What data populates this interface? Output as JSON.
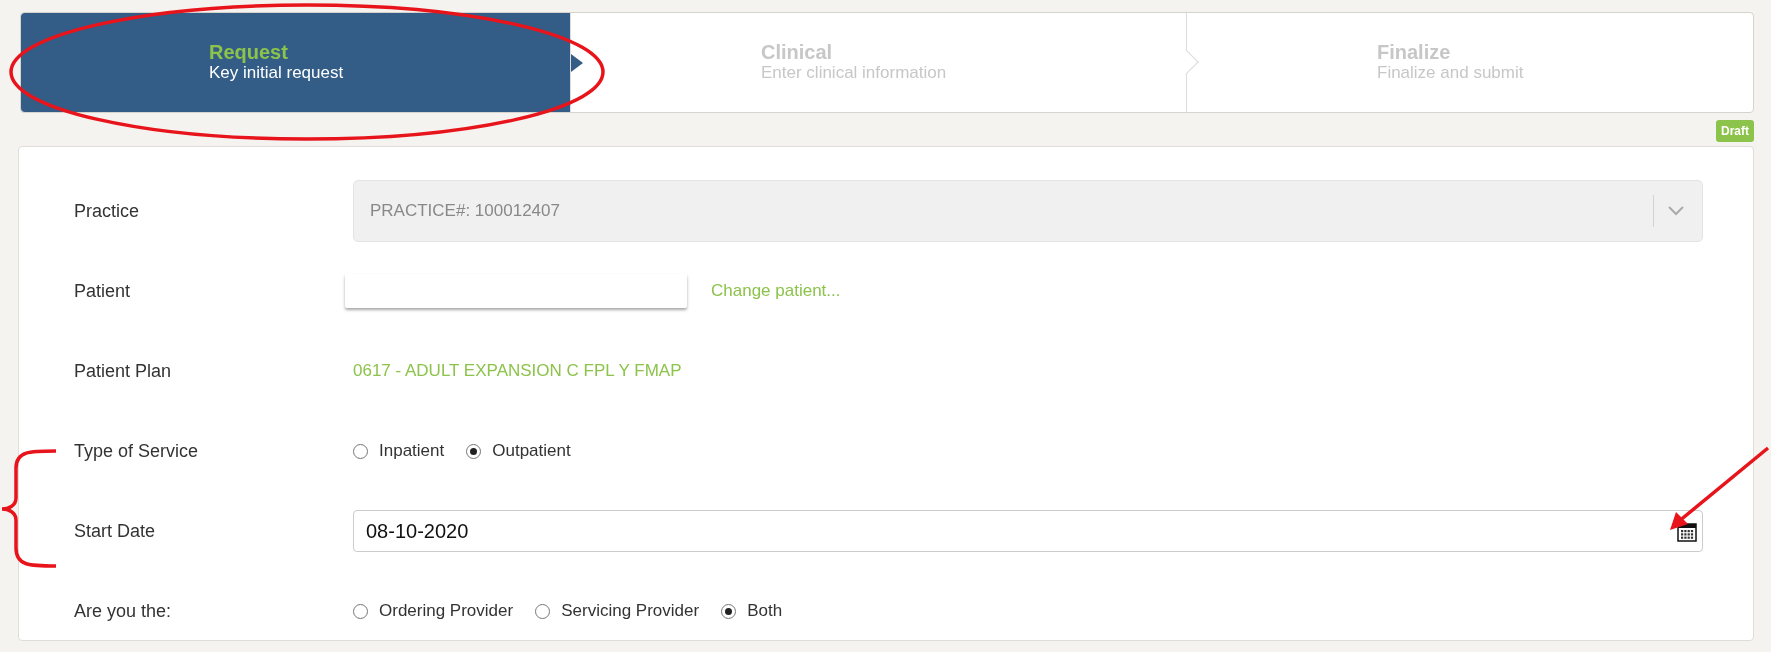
{
  "steps": [
    {
      "title": "Request",
      "subtitle": "Key initial request",
      "selected": true
    },
    {
      "title": "Clinical",
      "subtitle": "Enter clinical information",
      "selected": false
    },
    {
      "title": "Finalize",
      "subtitle": "Finalize and submit",
      "selected": false
    }
  ],
  "status_badge": "Draft",
  "fields": [
    {
      "kind": "select",
      "label": "Practice",
      "value": "PRACTICE#: 100012407",
      "disabled": true
    },
    {
      "kind": "patient",
      "label": "Patient",
      "link": "Change patient..."
    },
    {
      "kind": "text",
      "label": "Patient Plan",
      "value": "0617 - ADULT EXPANSION C FPL Y FMAP"
    },
    {
      "kind": "radio",
      "label": "Type of Service",
      "options": [
        {
          "label": "Inpatient",
          "selected": false
        },
        {
          "label": "Outpatient",
          "selected": true
        }
      ]
    },
    {
      "kind": "date",
      "label": "Start Date",
      "value": "08-10-2020"
    },
    {
      "kind": "radio",
      "label": "Are you the:",
      "options": [
        {
          "label": "Ordering Provider",
          "selected": false
        },
        {
          "label": "Servicing Provider",
          "selected": false
        },
        {
          "label": "Both",
          "selected": true
        }
      ]
    }
  ]
}
